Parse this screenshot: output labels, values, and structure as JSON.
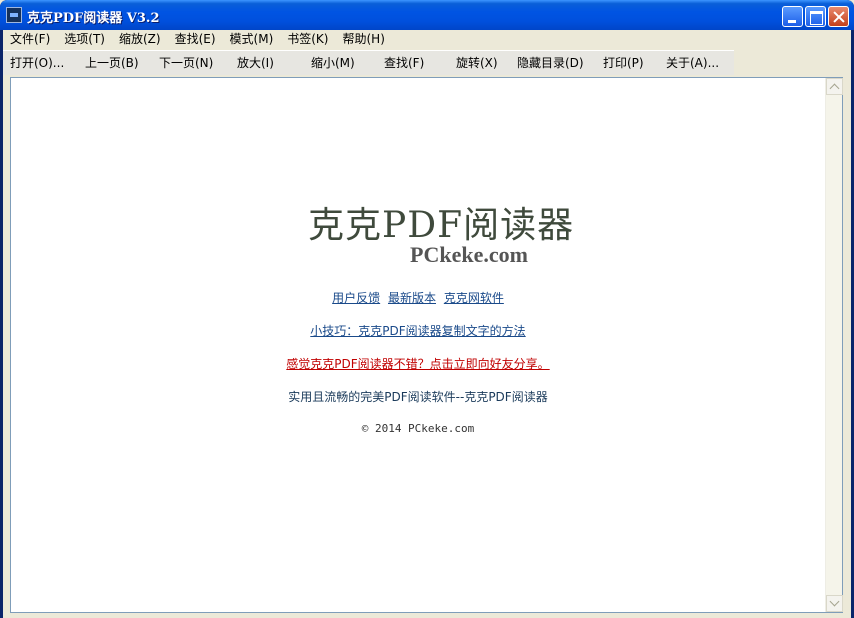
{
  "window": {
    "title": "克克PDF阅读器 V3.2"
  },
  "menubar": {
    "items": [
      {
        "label": "文件(F)"
      },
      {
        "label": "选项(T)"
      },
      {
        "label": "缩放(Z)"
      },
      {
        "label": "查找(E)"
      },
      {
        "label": "模式(M)"
      },
      {
        "label": "书签(K)"
      },
      {
        "label": "帮助(H)"
      }
    ]
  },
  "toolbar": {
    "open": "打开(O)...",
    "prev_page": "上一页(B)",
    "next_page": "下一页(N)",
    "zoom_in": "放大(I)",
    "zoom_out": "缩小(M)",
    "find": "查找(F)",
    "rotate": "旋转(X)",
    "hide_toc": "隐藏目录(D)",
    "print": "打印(P)",
    "about": "关于(A)..."
  },
  "content": {
    "logo_title": "克克PDF阅读器",
    "logo_subtitle": "PCkeke.com",
    "links": {
      "feedback": "用户反馈",
      "latest_version": "最新版本",
      "kk_software": "克克网软件"
    },
    "tip": "小技巧：克克PDF阅读器复制文字的方法",
    "share": "感觉克克PDF阅读器不错？点击立即向好友分享。",
    "tagline": "实用且流畅的完美PDF阅读软件--克克PDF阅读器",
    "copyright": "© 2014 PCkeke.com"
  }
}
